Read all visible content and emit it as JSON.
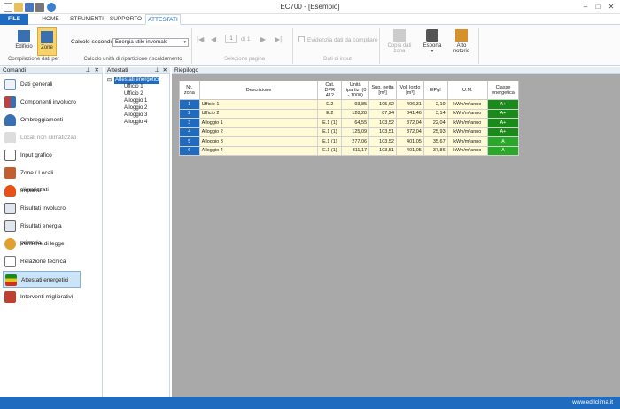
{
  "window": {
    "title": "EC700 - [Esempio]"
  },
  "tabs": [
    {
      "label": "FILE"
    },
    {
      "label": "HOME"
    },
    {
      "label": "STRUMENTI"
    },
    {
      "label": "SUPPORTO"
    },
    {
      "label": "ATTESTATI"
    }
  ],
  "ribbon": {
    "edificio": "Edificio",
    "zone": "Zone",
    "group1": "Compilazione dati per",
    "calcolo_label": "Calcolo secondo",
    "calcolo_value": "Energia utile invernale",
    "group2": "Calcolo unità di ripartizione riscaldamento",
    "page_current": "1",
    "page_of": "di 1",
    "group3": "Selezione pagina",
    "evidenzia": "Evidenzia dati da compilare",
    "group4": "Dati di input",
    "copia": "Copia dati zona",
    "esporta": "Esporta",
    "atto": "Atto notorio"
  },
  "colors": {
    "accent": "#1f6bbf",
    "row_bg": "#fffbd6",
    "class_a_plus": "#1a8a1a",
    "class_a": "#2aa82a"
  },
  "comandi": {
    "title": "Comandi",
    "items": [
      {
        "label": "Dati generali",
        "icon": "document-icon"
      },
      {
        "label": "Componenti involucro",
        "icon": "components-icon"
      },
      {
        "label": "Ombreggiamenti",
        "icon": "shading-icon"
      },
      {
        "label": "Locali non climatizzati",
        "icon": "house-icon"
      },
      {
        "label": "Input grafico",
        "icon": "graph-icon"
      },
      {
        "label": "Zone / Locali climatizzati",
        "icon": "zones-icon"
      },
      {
        "label": "Impianti",
        "icon": "flame-icon"
      },
      {
        "label": "Risultati involucro",
        "icon": "calculator-icon"
      },
      {
        "label": "Risultati energia primaria",
        "icon": "calculator-icon"
      },
      {
        "label": "Verifiche di legge",
        "icon": "gear-icon"
      },
      {
        "label": "Relazione tecnica",
        "icon": "report-icon"
      },
      {
        "label": "Attestati energetici",
        "icon": "certificate-icon"
      },
      {
        "label": "Interventi migliorativi",
        "icon": "house-tools-icon"
      }
    ]
  },
  "attestati": {
    "title": "Attestati",
    "root": "Attestati energetici",
    "children": [
      "Ufficio 1",
      "Ufficio 2",
      "Alloggio 1",
      "Alloggio 2",
      "Alloggio 3",
      "Alloggio 4"
    ]
  },
  "riepilogo": {
    "title": "Riepilogo",
    "headers": [
      "Nr. zona",
      "Descrizione",
      "Cat. DPR 412",
      "Unità ripartiz. (0 - 1000)",
      "Sup. netta [m²]",
      "Vol. lordo [m³]",
      "EPgl",
      "U.M.",
      "Classe energetica"
    ],
    "rows": [
      {
        "nr": "1",
        "desc": "Ufficio 1",
        "cat": "E.2",
        "unita": "93,85",
        "sup": "105,62",
        "vol": "406,31",
        "ep": "2,19",
        "um": "kWh/m²anno",
        "cls": "A+"
      },
      {
        "nr": "2",
        "desc": "Ufficio 2",
        "cat": "E.2",
        "unita": "128,28",
        "sup": "87,24",
        "vol": "341,46",
        "ep": "3,14",
        "um": "kWh/m²anno",
        "cls": "A+"
      },
      {
        "nr": "3",
        "desc": "Alloggio 1",
        "cat": "E.1 (1)",
        "unita": "64,55",
        "sup": "103,52",
        "vol": "372,04",
        "ep": "22,04",
        "um": "kWh/m²anno",
        "cls": "A+"
      },
      {
        "nr": "4",
        "desc": "Alloggio 2",
        "cat": "E.1 (1)",
        "unita": "125,09",
        "sup": "103,51",
        "vol": "372,04",
        "ep": "25,93",
        "um": "kWh/m²anno",
        "cls": "A+"
      },
      {
        "nr": "5",
        "desc": "Alloggio 3",
        "cat": "E.1 (1)",
        "unita": "277,06",
        "sup": "103,52",
        "vol": "401,05",
        "ep": "35,67",
        "um": "kWh/m²anno",
        "cls": "A"
      },
      {
        "nr": "6",
        "desc": "Alloggio 4",
        "cat": "E.1 (1)",
        "unita": "311,17",
        "sup": "103,51",
        "vol": "401,05",
        "ep": "37,86",
        "um": "kWh/m²anno",
        "cls": "A"
      }
    ]
  },
  "status": {
    "url": "www.edilclima.it"
  }
}
